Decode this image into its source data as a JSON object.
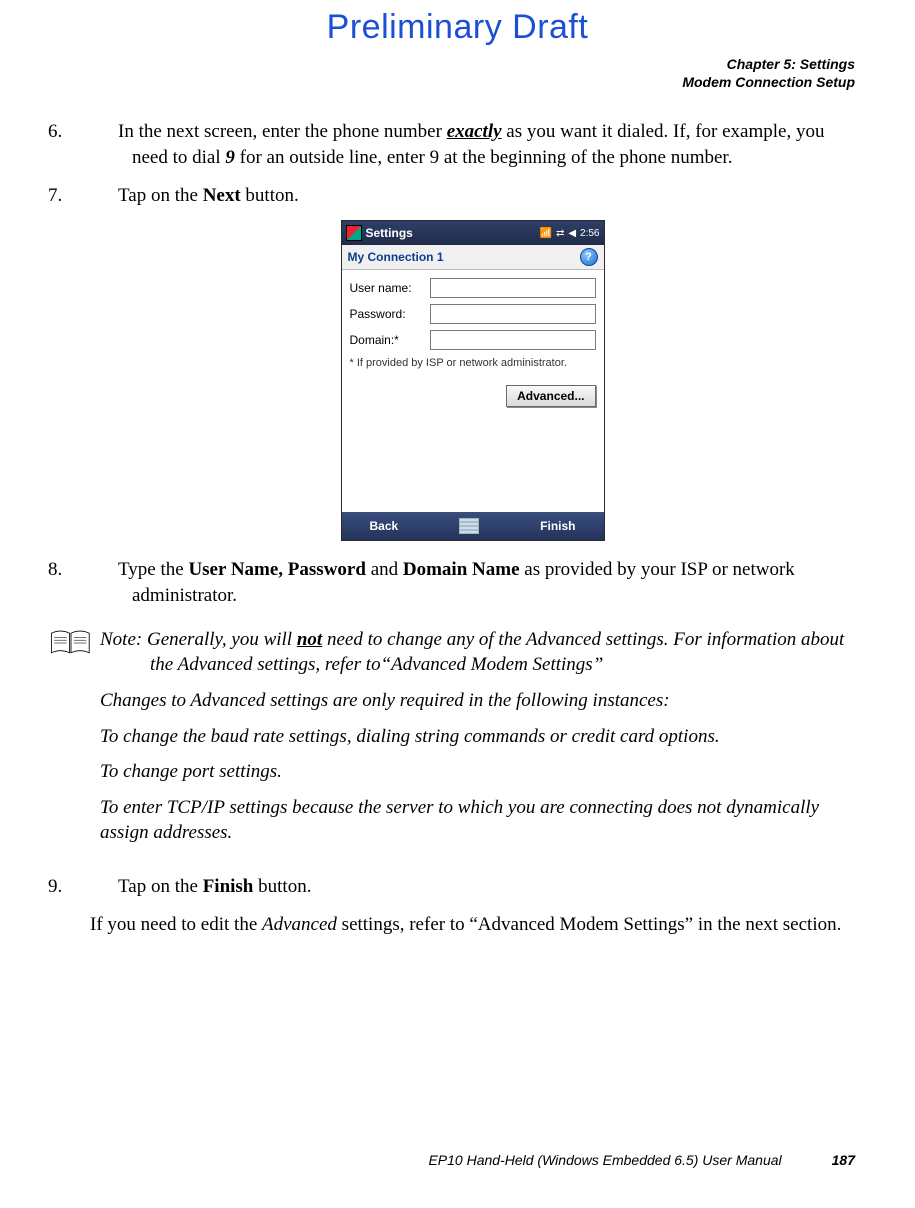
{
  "draft_title": "Preliminary Draft",
  "header": {
    "chapter": "Chapter 5: Settings",
    "section": "Modem Connection Setup"
  },
  "steps": {
    "s6": {
      "num": "6.",
      "t1": "In the next screen, enter the phone number ",
      "t2": "exactly",
      "t3": " as you want it dialed. If, for example, you need to dial ",
      "t4": "9",
      "t5": " for an outside line, enter 9 at the beginning of the phone number."
    },
    "s7": {
      "num": "7.",
      "t1": "Tap on the ",
      "t2": "Next",
      "t3": " button."
    },
    "s8": {
      "num": "8.",
      "t1": "Type the ",
      "t2": "User Name, Password",
      "t3": " and ",
      "t4": "Domain Name",
      "t5": " as provided by your ISP or network administrator."
    },
    "s9": {
      "num": "9.",
      "t1": "Tap on the ",
      "t2": "Finish",
      "t3": " button."
    }
  },
  "screenshot": {
    "topbar_title": "Settings",
    "time": "2:56",
    "connection_name": "My Connection 1",
    "help_glyph": "?",
    "labels": {
      "user": "User name:",
      "pass": "Password:",
      "domain": "Domain:*"
    },
    "footnote": "* If provided by ISP or network administrator.",
    "advanced_btn": "Advanced...",
    "back": "Back",
    "finish": "Finish"
  },
  "note": {
    "prefix": "Note:",
    "l1a": " Generally, you will ",
    "l1b": "not",
    "l1c": " need to change any of the Advanced settings. For information about the Advanced settings, refer to“Advanced Modem Settings”",
    "l2": "Changes to Advanced settings are only required in the following instances:",
    "l3": "To change the baud rate settings, dialing string commands or credit card options.",
    "l4": "To change port settings.",
    "l5": "To enter TCP/IP settings because the server to which you are connecting does not dynamically assign addresses."
  },
  "closing": {
    "t1": "If you need to edit the ",
    "t2": "Advanced",
    "t3": " settings, refer to “Advanced Modem Settings” in the next section."
  },
  "footer": {
    "manual": "EP10 Hand-Held (Windows Embedded 6.5) User Manual",
    "page": "187"
  }
}
